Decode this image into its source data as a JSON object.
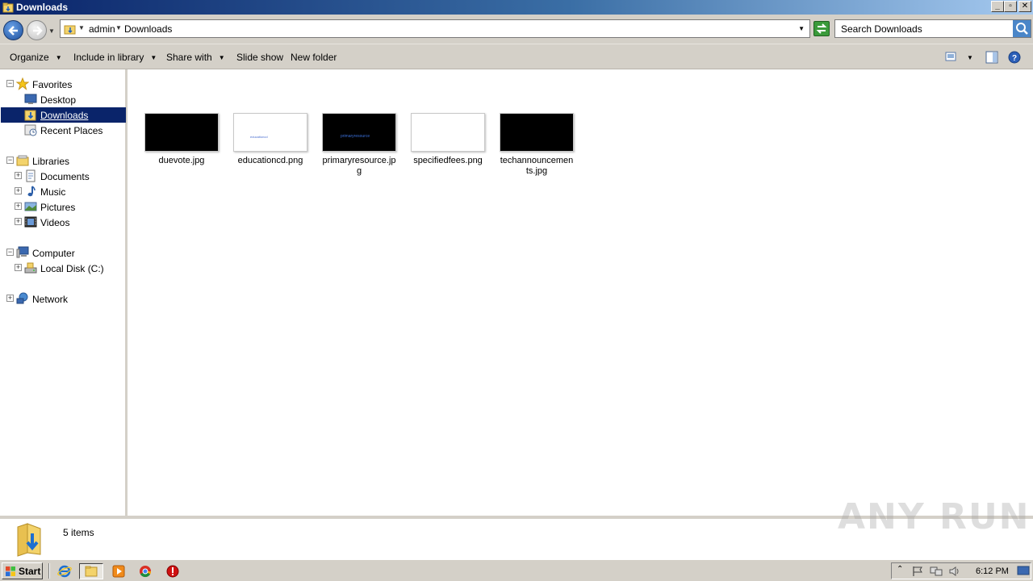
{
  "window": {
    "title": "Downloads",
    "controls": {
      "minimize": "_",
      "maximize": "▫",
      "close": "✕"
    }
  },
  "address": {
    "crumbs": [
      "admin",
      "Downloads"
    ],
    "search_placeholder": "Search Downloads"
  },
  "toolbar": {
    "organize": "Organize",
    "include_in_library": "Include in library",
    "share_with": "Share with",
    "slide_show": "Slide show",
    "new_folder": "New folder"
  },
  "nav": {
    "favorites": {
      "label": "Favorites",
      "items": [
        "Desktop",
        "Downloads",
        "Recent Places"
      ]
    },
    "libraries": {
      "label": "Libraries",
      "items": [
        "Documents",
        "Music",
        "Pictures",
        "Videos"
      ]
    },
    "computer": {
      "label": "Computer",
      "items": [
        "Local Disk (C:)"
      ]
    },
    "network": {
      "label": "Network"
    },
    "selected": "Downloads"
  },
  "files": [
    {
      "name": "duevote.jpg",
      "thumb_bg": "#000000",
      "thumb_text": "",
      "thumb_text_color": "#000000"
    },
    {
      "name": "educationcd.png",
      "thumb_bg": "#ffffff",
      "thumb_text": "educationcd",
      "thumb_text_color": "#4a6fd0"
    },
    {
      "name": "primaryresource.jpg",
      "thumb_bg": "#000000",
      "thumb_text": "primaryresource",
      "thumb_text_color": "#3a6fd8"
    },
    {
      "name": "specifiedfees.png",
      "thumb_bg": "#ffffff",
      "thumb_text": "",
      "thumb_text_color": "#888888"
    },
    {
      "name": "techannouncements.jpg",
      "thumb_bg": "#000000",
      "thumb_text": "",
      "thumb_text_color": "#666666"
    }
  ],
  "status": {
    "item_count": "5 items"
  },
  "watermark": "ANY RUN",
  "taskbar": {
    "start_label": "Start",
    "clock": "6:12 PM"
  },
  "colors": {
    "selection": "#0a246a",
    "title_gradient_start": "#0a246a",
    "title_gradient_end": "#a6caf0",
    "chrome": "#d4d0c8"
  }
}
